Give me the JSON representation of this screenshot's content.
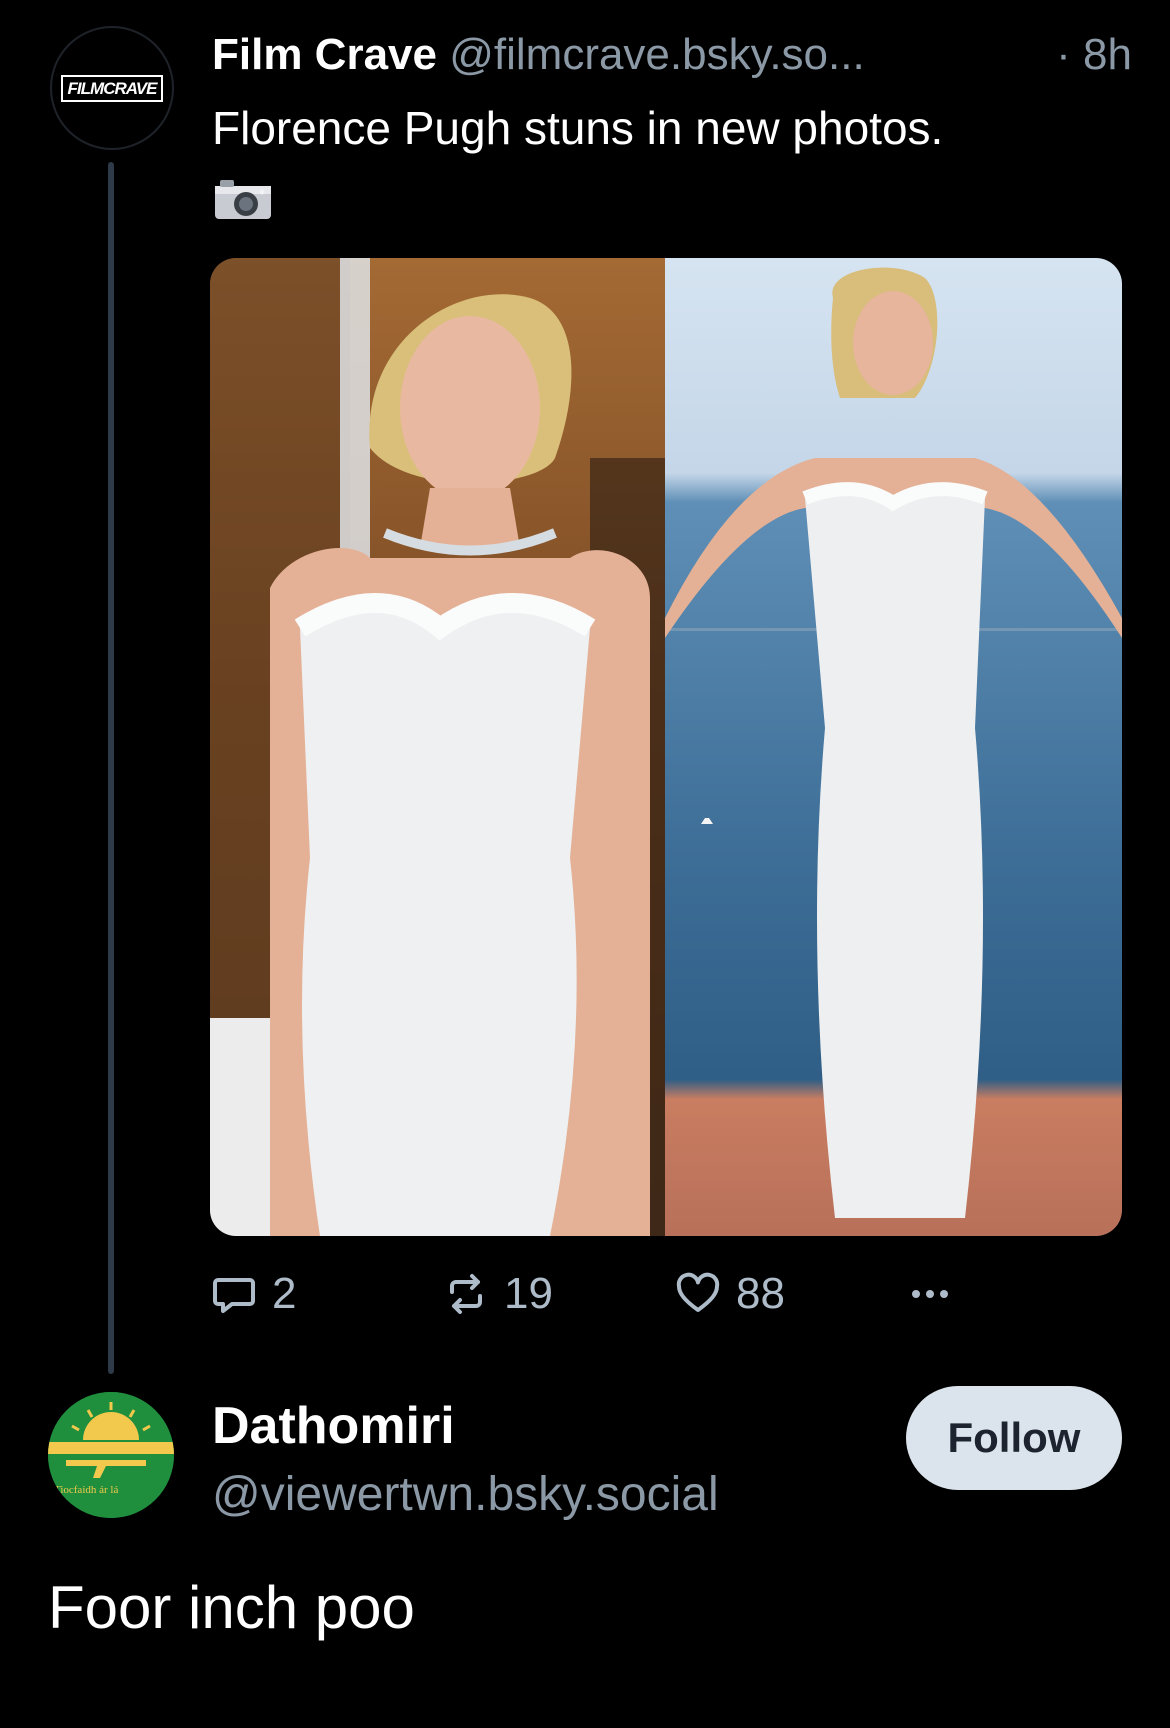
{
  "post": {
    "author_name": "Film Crave",
    "author_handle": "@filmcrave.bsky.so...",
    "time": "· 8h",
    "avatar_text": "FILMCRAVE",
    "text": "Florence Pugh stuns in new photos.",
    "emoji": "camera-icon",
    "actions": {
      "replies": "2",
      "reposts": "19",
      "likes": "88"
    }
  },
  "reply": {
    "author_name": "Dathomiri",
    "author_handle": "@viewertwn.bsky.social",
    "avatar_text": "Tiocfaidh ár lá",
    "follow_label": "Follow",
    "text": "Foor inch poo"
  },
  "colors": {
    "background": "#000000",
    "secondary_text": "#8b98a5",
    "thread_line": "#2e3a47",
    "follow_button_bg": "#dbe3ec",
    "dathomiri_avatar": "#1f8e3d"
  }
}
